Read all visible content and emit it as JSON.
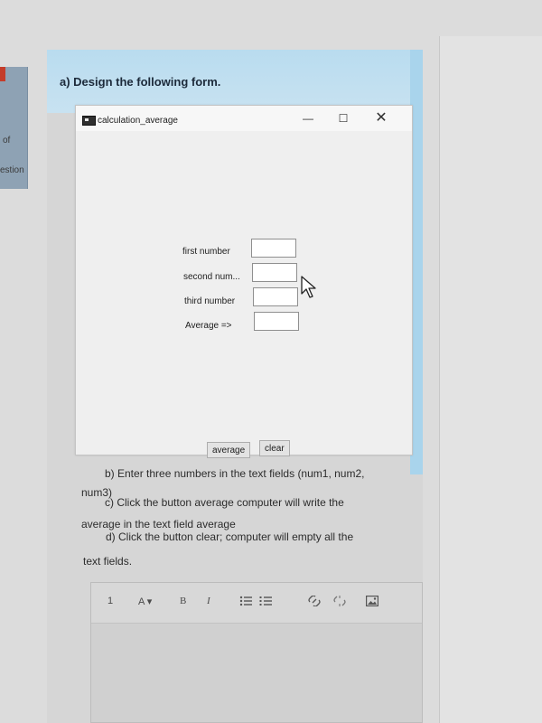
{
  "left_sidebar": {
    "text_of": "of",
    "text_stion": "estion"
  },
  "question": {
    "heading": "a) Design the following form."
  },
  "window": {
    "title": "calculation_average",
    "minimize": "—",
    "maximize": "☐",
    "close": "✕",
    "fields": [
      {
        "label": "first number",
        "value": ""
      },
      {
        "label": "second num...",
        "value": ""
      },
      {
        "label": "third number",
        "value": ""
      },
      {
        "label": "Average =>",
        "value": ""
      }
    ],
    "buttons": {
      "average": "average",
      "clear": "clear"
    }
  },
  "instructions": {
    "b_line1": "b) Enter three numbers in the text fields (num1, num2,",
    "b_line2": "num3)",
    "c_line1": "c) Click the button average computer will write the",
    "c_line2": "average in the text field average",
    "d_line1": "d) Click the button clear; computer will empty all the",
    "d_line2": "text fields."
  },
  "editor_toolbar": {
    "paragraph": "1",
    "font": "A ▾",
    "bold": "B",
    "italic": "I"
  }
}
